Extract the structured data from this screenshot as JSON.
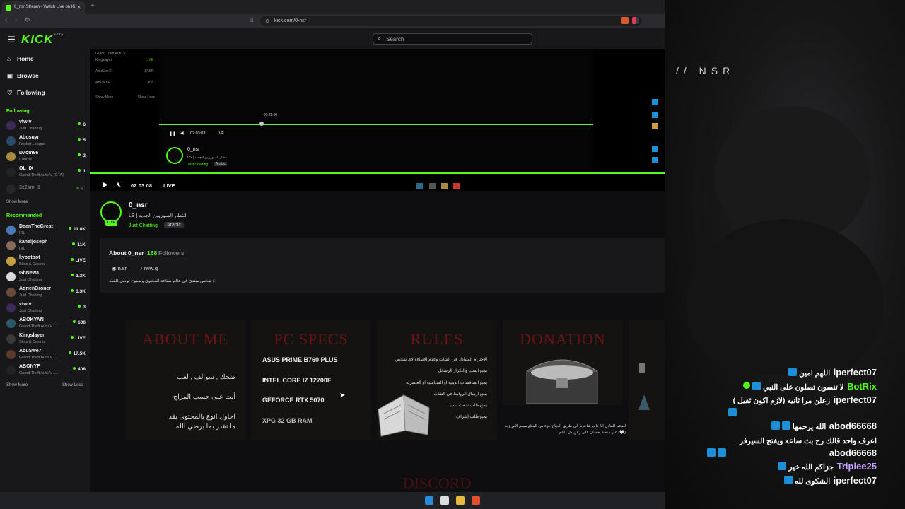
{
  "browser": {
    "tab_title": "0_nsr Stream - Watch Live on Ki",
    "tab_close": "✕",
    "new_tab": "+",
    "url": "kick.com/0-nsr"
  },
  "header": {
    "logo": "KICK",
    "logo_badge": "BETA",
    "search_placeholder": "Search"
  },
  "sidebar": {
    "nav": [
      {
        "label": "Home",
        "icon": "home-icon"
      },
      {
        "label": "Browse",
        "icon": "browse-icon"
      },
      {
        "label": "Following",
        "icon": "heart-icon"
      }
    ],
    "following_title": "Following",
    "following": [
      {
        "name": "vtwlv",
        "category": "Just Chatting",
        "viewers": "6"
      },
      {
        "name": "Abosuyr",
        "category": "Rocket League",
        "viewers": "5"
      },
      {
        "name": "D7om86",
        "category": "Control",
        "viewers": "2"
      },
      {
        "name": "OL_IX",
        "category": "Grand Theft Auto V (GTA)",
        "viewers": "1"
      },
      {
        "name": "3zZam_3",
        "category": "",
        "viewers": ""
      }
    ],
    "show_more": "Show More",
    "recommended_title": "Recommended",
    "recommended": [
      {
        "name": "DeenTheGreat",
        "category": "IRL",
        "viewers": "11.8K"
      },
      {
        "name": "kaneljoseph",
        "category": "IRL",
        "viewers": "11K"
      },
      {
        "name": "kyootbot",
        "category": "Slots & Casino",
        "viewers": "LIVE"
      },
      {
        "name": "GhNewa",
        "category": "Just Chatting",
        "viewers": "3.3K"
      },
      {
        "name": "AdrienBroner",
        "category": "Just Chatting",
        "viewers": "3.3K"
      },
      {
        "name": "vtwlv",
        "category": "Just Chatting",
        "viewers": "3"
      },
      {
        "name": "ABOKYAN",
        "category": "Grand Theft Auto V L...",
        "viewers": "600"
      },
      {
        "name": "Kingslayer",
        "category": "Slots & Casino",
        "viewers": "LIVE"
      },
      {
        "name": "AbuSwe7l",
        "category": "Grand Theft Auto V L...",
        "viewers": "17.5K"
      },
      {
        "name": "ABONYF",
        "category": "Grand Theft Auto V L...",
        "viewers": "408"
      }
    ],
    "show_more_2": "Show More",
    "show_less": "Show Less"
  },
  "player": {
    "time": "02:03:08",
    "live": "LIVE",
    "inner_time": "02:03:03",
    "inner_live": "LIVE",
    "inner_tooltip": "-00:21:00",
    "mini_rows": [
      {
        "name": "Grand Theft Auto V",
        "viewers": ""
      },
      {
        "name": "Kingslayer",
        "viewers": "LIVE"
      },
      {
        "name": "AbuSwe7l",
        "viewers": "17.5K"
      },
      {
        "name": "ABONYF",
        "viewers": "408"
      }
    ],
    "mini_show_more": "Show More",
    "mini_show_less": "Show Less"
  },
  "stream": {
    "channel": "0_nsr",
    "title": "LS | انتظار السوزوين الجديد",
    "category": "Just Chatting",
    "language": "Arabic",
    "live_badge": "LIVE"
  },
  "about": {
    "label": "About 0_nsr",
    "followers_count": "168",
    "followers_label": "Followers",
    "links": [
      {
        "icon": "discord-icon",
        "label": "n.sr"
      },
      {
        "icon": "tiktok-icon",
        "label": "nvw.q"
      }
    ],
    "bio": "شخص مبتدئ في عالم صناعة المحتوى وطموح توصل للقمة (:"
  },
  "panels": {
    "about_me": {
      "title": "ABOUT ME",
      "lines": [
        "ضحك , سوالف , لعب",
        "أبث على حسب المزاج",
        "احاول انوع بالمحتوى بقد",
        "ما نقدر بما يرضي الله"
      ]
    },
    "pc_specs": {
      "title": "PC SPECS",
      "lines": [
        "ASUS PRIME B760 PLUS",
        "INTEL CORE I7 12700F",
        "GEFORCE RTX 5070",
        "XPG 32 GB RAM"
      ]
    },
    "rules": {
      "title": "RULES",
      "lines": [
        "الاحترام المتبادل في الشات وعدم الإساءة لاي شخص",
        "يمنع السب والتكرار الرسائل",
        "يمنع المناقشات الدينية او السياسية او العنصرية",
        "يمنع ارسال الروابط في الشات",
        "يمنع طلب شفت سب",
        "يمنع طلب إشراف"
      ]
    },
    "donation": {
      "title": "DONATION",
      "caption": "للدعم المادي انا حاب شاعدنا الى طريق النجاح جزء من المبلغ سيتم التبرع به عبر منصة إحسان على رعن كل داعم (🤍)"
    },
    "discord_title": "DISCORD"
  },
  "overlay": {
    "brand": "// NSR",
    "chat": [
      {
        "user": "iperfect07",
        "color": "#ffffff",
        "message": "اللهم امين"
      },
      {
        "user": "BotRix",
        "color": "#53fc18",
        "message": "لا تنسون تصلون على النبي"
      },
      {
        "user": "iperfect07",
        "color": "#ffffff",
        "message": "زعلن مرا ثانيه (لازم اكون ثقيل )"
      },
      {
        "user": "abod66668",
        "color": "#ffffff",
        "message": "الله يرحمها"
      },
      {
        "user": "abod66668",
        "color": "#ffffff",
        "message": "اعرف واحد قالك رح بث ساعه ويفتح السيرفر"
      },
      {
        "user": "Triplee25",
        "color": "#c8a2ff",
        "message": "جزاكم الله خير"
      },
      {
        "user": "iperfect07",
        "color": "#ffffff",
        "message": "الشكوى لله"
      }
    ]
  }
}
